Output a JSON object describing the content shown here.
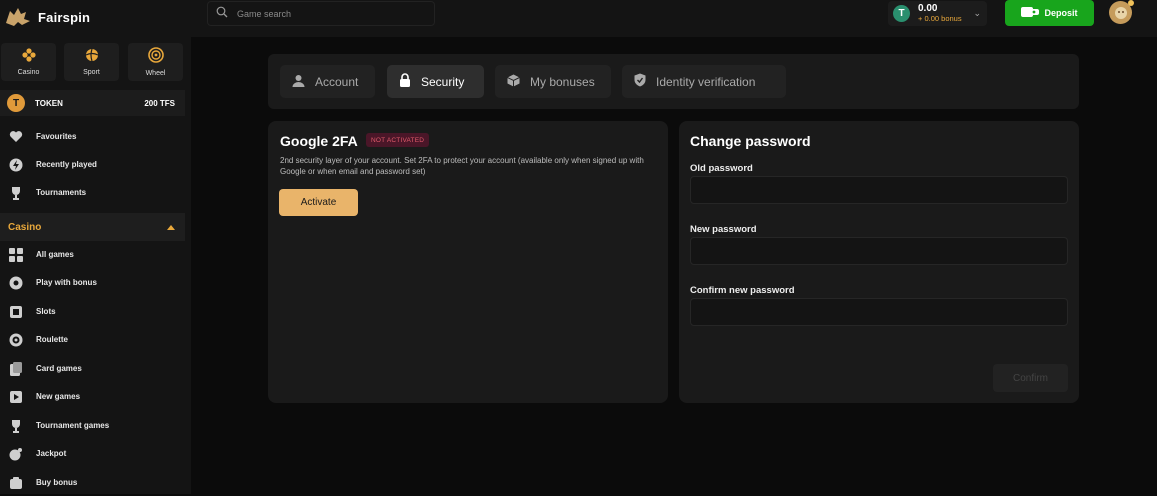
{
  "brand": {
    "name": "Fairspin"
  },
  "search": {
    "placeholder": "Game search"
  },
  "wallet": {
    "amount": "0.00",
    "bonus": "+ 0.00 bonus",
    "currency_icon": "T"
  },
  "header": {
    "deposit_label": "Deposit"
  },
  "quick_nav": [
    {
      "label": "Casino",
      "icon": "casino-icon"
    },
    {
      "label": "Sport",
      "icon": "sport-ball-icon"
    },
    {
      "label": "Wheel",
      "icon": "wheel-icon"
    }
  ],
  "token": {
    "icon": "T",
    "name": "TOKEN",
    "value": "200 TFS"
  },
  "sidebar_top": [
    {
      "label": "Favourites",
      "icon": "heart-icon"
    },
    {
      "label": "Recently played",
      "icon": "lightning-icon"
    },
    {
      "label": "Tournaments",
      "icon": "trophy-icon"
    }
  ],
  "casino_section": {
    "label": "Casino"
  },
  "casino_items": [
    {
      "label": "All games",
      "icon": "grid-icon"
    },
    {
      "label": "Play with bonus",
      "icon": "bonus-chip-icon"
    },
    {
      "label": "Slots",
      "icon": "slots-icon"
    },
    {
      "label": "Roulette",
      "icon": "roulette-icon"
    },
    {
      "label": "Card games",
      "icon": "cards-icon"
    },
    {
      "label": "New games",
      "icon": "new-games-icon"
    },
    {
      "label": "Tournament games",
      "icon": "trophy-icon"
    },
    {
      "label": "Jackpot",
      "icon": "jackpot-icon"
    },
    {
      "label": "Buy bonus",
      "icon": "buy-bonus-icon"
    }
  ],
  "tabs": [
    {
      "label": "Account",
      "icon": "user-icon"
    },
    {
      "label": "Security",
      "icon": "lock-icon"
    },
    {
      "label": "My bonuses",
      "icon": "box-icon"
    },
    {
      "label": "Identity verification",
      "icon": "shield-check-icon"
    }
  ],
  "active_tab": "Security",
  "twofa": {
    "title": "Google 2FA",
    "status": "NOT ACTIVATED",
    "description": "2nd security layer of your account. Set 2FA to protect your account (available only when signed up with Google or when email and password set)",
    "button": "Activate"
  },
  "change_password": {
    "title": "Change password",
    "old_label": "Old password",
    "old_value": "",
    "new_label": "New password",
    "new_value": "",
    "confirm_label": "Confirm new password",
    "confirm_value": "",
    "submit": "Confirm"
  },
  "colors": {
    "accent": "#e9b46a",
    "deposit": "#18a51c",
    "casino_header": "#e9a83b",
    "badge_text": "#e05a6a"
  }
}
